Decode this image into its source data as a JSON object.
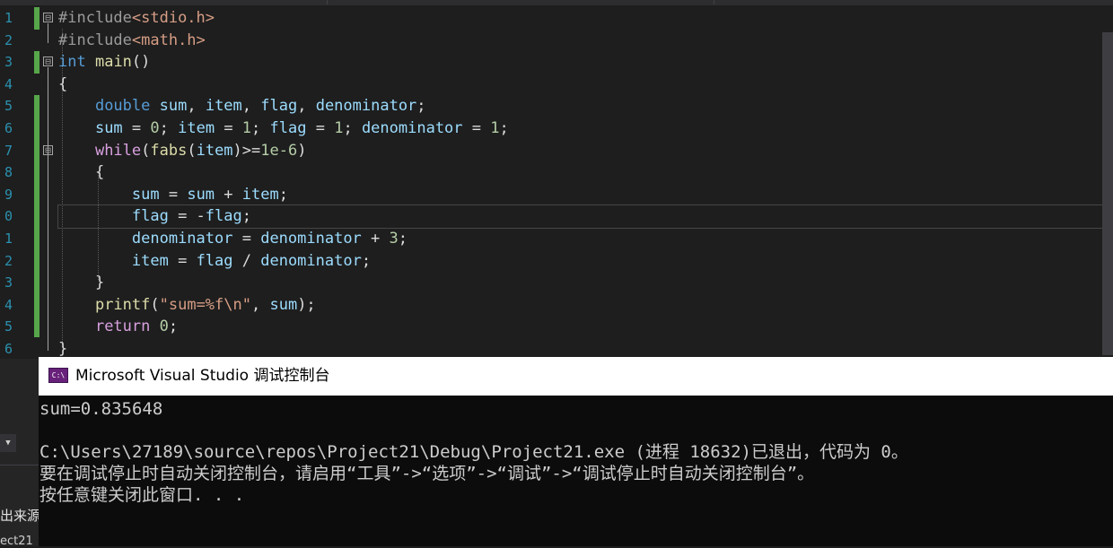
{
  "editor": {
    "line_numbers": [
      "1",
      "2",
      "3",
      "4",
      "5",
      "6",
      "7",
      "8",
      "9",
      "0",
      "1",
      "2",
      "3",
      "4",
      "5",
      "6"
    ],
    "lines": [
      [
        {
          "t": "#include",
          "c": "pp"
        },
        {
          "t": "<stdio.h>",
          "c": "str"
        }
      ],
      [
        {
          "t": "#include",
          "c": "pp"
        },
        {
          "t": "<math.h>",
          "c": "str"
        }
      ],
      [
        {
          "t": "int",
          "c": "kw"
        },
        {
          "t": " "
        },
        {
          "t": "main",
          "c": "fn"
        },
        {
          "t": "()"
        }
      ],
      [
        {
          "t": "{"
        }
      ],
      [
        {
          "t": "    "
        },
        {
          "t": "double",
          "c": "kw"
        },
        {
          "t": " "
        },
        {
          "t": "sum",
          "c": "var"
        },
        {
          "t": ", "
        },
        {
          "t": "item",
          "c": "var"
        },
        {
          "t": ", "
        },
        {
          "t": "flag",
          "c": "var"
        },
        {
          "t": ", "
        },
        {
          "t": "denominator",
          "c": "var"
        },
        {
          "t": ";"
        }
      ],
      [
        {
          "t": "    "
        },
        {
          "t": "sum",
          "c": "var"
        },
        {
          "t": " = "
        },
        {
          "t": "0",
          "c": "num"
        },
        {
          "t": "; "
        },
        {
          "t": "item",
          "c": "var"
        },
        {
          "t": " = "
        },
        {
          "t": "1",
          "c": "num"
        },
        {
          "t": "; "
        },
        {
          "t": "flag",
          "c": "var"
        },
        {
          "t": " = "
        },
        {
          "t": "1",
          "c": "num"
        },
        {
          "t": "; "
        },
        {
          "t": "denominator",
          "c": "var"
        },
        {
          "t": " = "
        },
        {
          "t": "1",
          "c": "num"
        },
        {
          "t": ";"
        }
      ],
      [
        {
          "t": "    "
        },
        {
          "t": "while",
          "c": "ctrl"
        },
        {
          "t": "("
        },
        {
          "t": "fabs",
          "c": "fn"
        },
        {
          "t": "("
        },
        {
          "t": "item",
          "c": "var"
        },
        {
          "t": ")>="
        },
        {
          "t": "1e-6",
          "c": "num"
        },
        {
          "t": ")"
        }
      ],
      [
        {
          "t": "    {"
        }
      ],
      [
        {
          "t": "        "
        },
        {
          "t": "sum",
          "c": "var"
        },
        {
          "t": " = "
        },
        {
          "t": "sum",
          "c": "var"
        },
        {
          "t": " + "
        },
        {
          "t": "item",
          "c": "var"
        },
        {
          "t": ";"
        }
      ],
      [
        {
          "t": "        "
        },
        {
          "t": "flag",
          "c": "var"
        },
        {
          "t": " = -"
        },
        {
          "t": "flag",
          "c": "var"
        },
        {
          "t": ";"
        }
      ],
      [
        {
          "t": "        "
        },
        {
          "t": "denominator",
          "c": "var"
        },
        {
          "t": " = "
        },
        {
          "t": "denominator",
          "c": "var"
        },
        {
          "t": " + "
        },
        {
          "t": "3",
          "c": "num"
        },
        {
          "t": ";"
        }
      ],
      [
        {
          "t": "        "
        },
        {
          "t": "item",
          "c": "var"
        },
        {
          "t": " = "
        },
        {
          "t": "flag",
          "c": "var"
        },
        {
          "t": " / "
        },
        {
          "t": "denominator",
          "c": "var"
        },
        {
          "t": ";"
        }
      ],
      [
        {
          "t": "    }"
        }
      ],
      [
        {
          "t": "    "
        },
        {
          "t": "printf",
          "c": "fn"
        },
        {
          "t": "("
        },
        {
          "t": "\"sum=%f\\n\"",
          "c": "str"
        },
        {
          "t": ", "
        },
        {
          "t": "sum",
          "c": "var"
        },
        {
          "t": ");"
        }
      ],
      [
        {
          "t": "    "
        },
        {
          "t": "return",
          "c": "ctrl"
        },
        {
          "t": " "
        },
        {
          "t": "0",
          "c": "num"
        },
        {
          "t": ";"
        }
      ],
      [
        {
          "t": "}"
        }
      ]
    ],
    "current_line_index": 9,
    "fold_markers": [
      "⊟",
      "⊟",
      "⊟"
    ]
  },
  "left_panel": {
    "dropdown_glyph": "▼",
    "text_1": "出来源",
    "text_2": "ect21"
  },
  "console": {
    "title": "Microsoft Visual Studio 调试控制台",
    "icon_label": "C:\\",
    "output_lines": [
      "sum=0.835648",
      "",
      "C:\\Users\\27189\\source\\repos\\Project21\\Debug\\Project21.exe (进程 18632)已退出，代码为 0。",
      "要在调试停止时自动关闭控制台，请启用“工具”->“选项”->“调试”->“调试停止时自动关闭控制台”。",
      "按任意键关闭此窗口. . ."
    ]
  },
  "colors": {
    "editor_bg": "#1e1e1e",
    "keyword": "#569cd6",
    "variable": "#9cdcfe",
    "string": "#d69d85",
    "number": "#b5cea8",
    "function": "#dcdcaa",
    "control": "#d8a0df",
    "line_number": "#2b91af",
    "changed_bar": "#57a64a"
  }
}
